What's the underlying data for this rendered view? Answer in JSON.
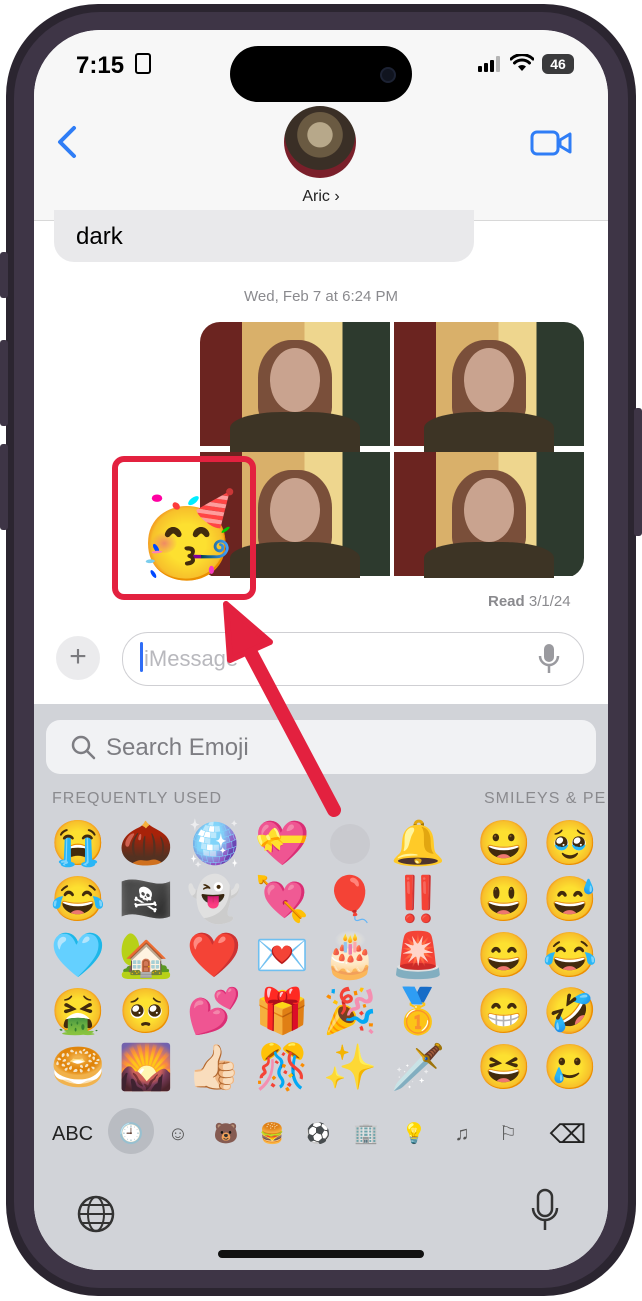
{
  "status_bar": {
    "time": "7:15",
    "battery": "46"
  },
  "header": {
    "contact_name": "Aric ›"
  },
  "conversation": {
    "incoming_message_text": "dark",
    "timestamp": "Wed, Feb 7 at 6:24 PM",
    "read_receipt_label": "Read",
    "read_receipt_date": "3/1/24",
    "sticker_emoji": "🥳"
  },
  "compose": {
    "plus_label": "+",
    "placeholder": "iMessage"
  },
  "emoji_keyboard": {
    "search_placeholder": "Search Emoji",
    "section_frequently_used": "FREQUENTLY USED",
    "section_smileys": "SMILEYS & PE",
    "frequently_used_columns": [
      [
        "😭",
        "😂",
        "🩵",
        "🤮",
        "🥯"
      ],
      [
        "🌰",
        "🏴‍☠️",
        "🏡",
        "🥺",
        "🌄"
      ],
      [
        "🪩",
        "👻",
        "❤️",
        "💕",
        "👍🏻"
      ],
      [
        "💝",
        "💘",
        "💌",
        "🎁",
        "🎊"
      ],
      [
        "",
        "🎈",
        "🎂",
        "🎉",
        "✨"
      ],
      [
        "🔔",
        "‼️",
        "🚨",
        "🥇",
        "🗡️"
      ]
    ],
    "smileys_columns": [
      [
        "😀",
        "😃",
        "😄",
        "😁",
        "😆"
      ],
      [
        "🥹",
        "😅",
        "😂",
        "🤣",
        "🥲"
      ]
    ],
    "bottom_bar": {
      "abc_label": "ABC",
      "category_icons": [
        "🕘",
        "☺",
        "🐻",
        "🍔",
        "⚽",
        "🏢",
        "💡",
        "♫",
        "⚐",
        "⌫"
      ]
    }
  },
  "colors": {
    "highlight_box": "#e3213f",
    "ios_blue": "#2f7df6",
    "keyboard_bg": "#d1d3d8"
  }
}
